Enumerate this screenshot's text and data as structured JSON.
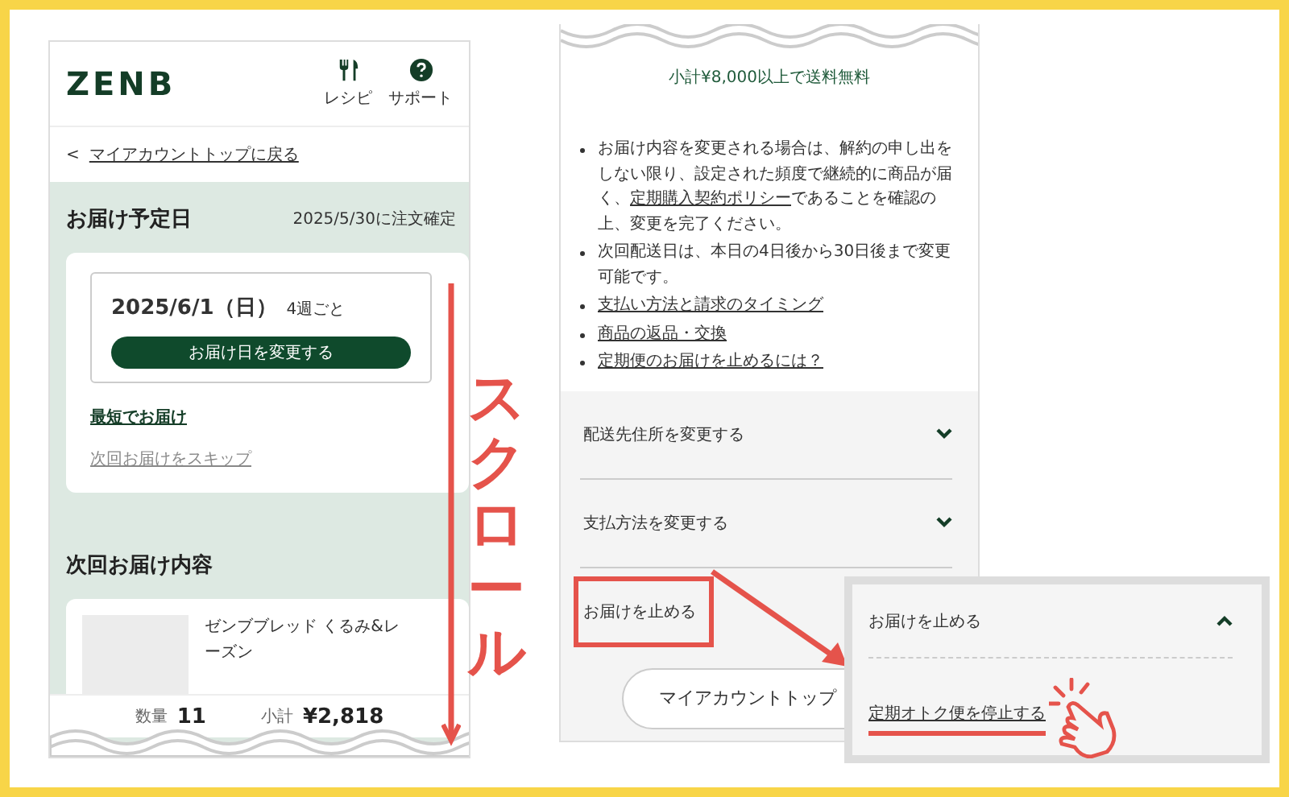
{
  "left_screen": {
    "logo": "ZENB",
    "nav": [
      {
        "label": "レシピ",
        "kind": "recipe"
      },
      {
        "label": "サポート",
        "kind": "support"
      }
    ],
    "back_link": {
      "icon": "<",
      "label": "マイアカウントトップに戻る"
    },
    "delivery": {
      "title": "お届け予定日",
      "confirm_note": "2025/5/30に注文確定",
      "date": "2025/6/1（日）",
      "frequency": "4週ごと",
      "change_button": "お届け日を変更する",
      "fastest_link": "最短でお届け",
      "skip_link": "次回お届けをスキップ"
    },
    "next_title": "次回お届け内容",
    "product": {
      "name": "ゼンブブレッド くるみ&レーズン"
    },
    "summary": {
      "qty_label": "数量",
      "qty": "11",
      "subtotal_label": "小計",
      "subtotal": "¥2,818"
    }
  },
  "right_screen": {
    "shipping_note": "小計¥8,000以上で送料無料",
    "bullets": [
      {
        "parts": [
          {
            "text": "お届け内容を変更される場合は、解約の申し出をしない限り、設定された頻度で継続的に商品が届く、",
            "link": false
          },
          {
            "text": "定期購入契約ポリシー",
            "link": true
          },
          {
            "text": "であることを確認の上、変更を完了ください。",
            "link": false
          }
        ]
      },
      {
        "parts": [
          {
            "text": "次回配送日は、本日の4日後から30日後まで変更可能です。",
            "link": false
          }
        ]
      },
      {
        "parts": [
          {
            "text": "支払い方法と請求のタイミング",
            "link": true
          }
        ]
      },
      {
        "parts": [
          {
            "text": "商品の返品・交換",
            "link": true
          }
        ]
      },
      {
        "parts": [
          {
            "text": "定期便のお届けを止めるには？",
            "link": true
          }
        ]
      }
    ],
    "accordions": [
      {
        "label": "配送先住所を変更する",
        "expanded": false,
        "highlighted": false
      },
      {
        "label": "支払方法を変更する",
        "expanded": false,
        "highlighted": false
      },
      {
        "label": "お届けを止める",
        "highlighted": true
      }
    ],
    "account_button": "マイアカウントトップ"
  },
  "zoom_popup": {
    "title": "お届けを止める",
    "expanded": true,
    "link": "定期オトク便を停止する"
  },
  "annotation": {
    "scroll_label": "スクロール"
  }
}
